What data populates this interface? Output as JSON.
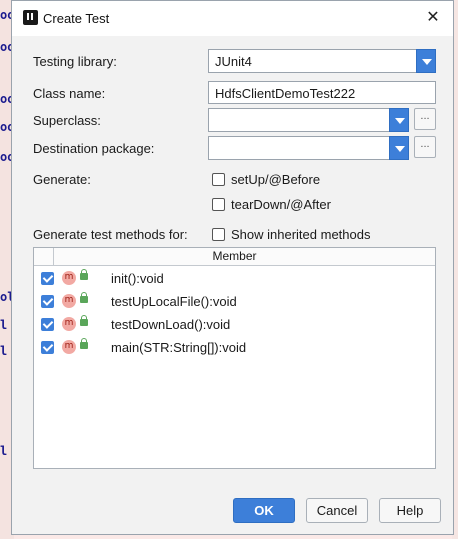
{
  "background": {
    "code_fragments": [
      "oo",
      "oo",
      "oo",
      "oo",
      "oo",
      "ol",
      "l",
      "l",
      "l"
    ]
  },
  "dialog": {
    "title": "Create Test",
    "testing_library": {
      "label": "Testing library:",
      "value": "JUnit4"
    },
    "class_name": {
      "label": "Class name:",
      "value": "HdfsClientDemoTest222"
    },
    "superclass": {
      "label": "Superclass:",
      "value": ""
    },
    "destination_package": {
      "label": "Destination package:",
      "value": ""
    },
    "generate": {
      "label": "Generate:",
      "setup_label": "setUp/@Before",
      "setup_checked": false,
      "teardown_label": "tearDown/@After",
      "teardown_checked": false
    },
    "methods_label": "Generate test methods for:",
    "show_inherited": {
      "label": "Show inherited methods",
      "checked": false
    },
    "more_button": "...",
    "table": {
      "header": "Member",
      "rows": [
        {
          "name": "init():void",
          "checked": true
        },
        {
          "name": "testUpLocalFile():void",
          "checked": true
        },
        {
          "name": "testDownLoad():void",
          "checked": true
        },
        {
          "name": "main(STR:String[]):void",
          "checked": true
        }
      ]
    },
    "buttons": {
      "ok": "OK",
      "cancel": "Cancel",
      "help": "Help"
    },
    "icons": {
      "method": "m",
      "close": "✕"
    }
  }
}
